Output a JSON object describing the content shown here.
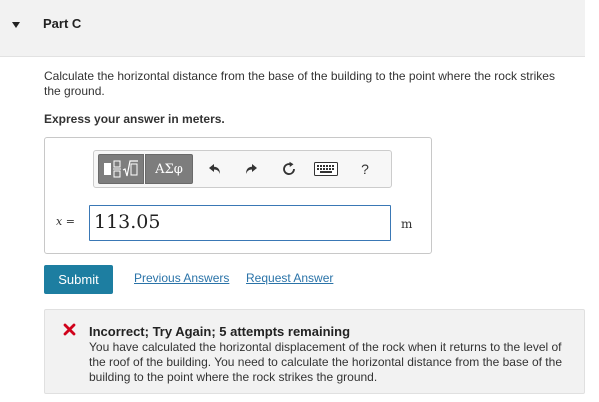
{
  "part": {
    "title": "Part C"
  },
  "question": {
    "text": "Calculate the horizontal distance from the base of the building to the point where the rock strikes the ground.",
    "instruction": "Express your answer in meters."
  },
  "toolbar": {
    "templates_icon": "templates-icon",
    "symbols_label": "ΑΣφ",
    "undo_icon": "undo-icon",
    "redo_icon": "redo-icon",
    "reset_icon": "reset-icon",
    "keyboard_icon": "keyboard-icon",
    "help_label": "?"
  },
  "answer": {
    "variable": "x",
    "equals": "=",
    "value": "113.05",
    "unit": "m"
  },
  "actions": {
    "submit_label": "Submit",
    "previous_answers_label": "Previous Answers",
    "request_answer_label": "Request Answer"
  },
  "feedback": {
    "status_icon": "incorrect-x-icon",
    "title": "Incorrect; Try Again; 5 attempts remaining",
    "text": "You have calculated the horizontal displacement of the rock when it returns to the level of the roof of the building. You need to calculate the horizontal distance from the base of the building to the point where the rock strikes the ground."
  },
  "colors": {
    "accent": "#1d7ea1",
    "link": "#2a73a8",
    "error": "#d0021b",
    "input_border": "#3a78b5"
  }
}
